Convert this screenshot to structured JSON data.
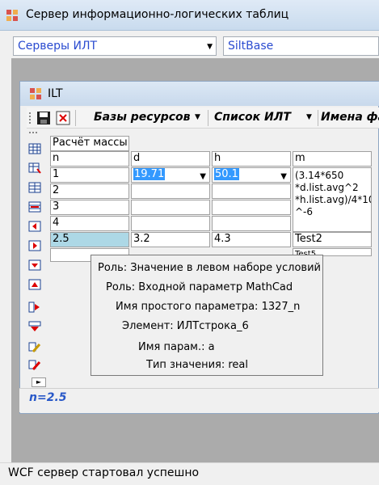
{
  "app": {
    "title": "Сервер информационно-логических таблиц"
  },
  "combos": {
    "servers": "Серверы ИЛТ",
    "base": "SiltBase"
  },
  "child": {
    "title": "ILT"
  },
  "toolbar": {
    "resources": "Базы ресурсов",
    "ilt_list": "Список ИЛТ",
    "names": "Имена фа"
  },
  "table": {
    "caption": "Расчёт массы",
    "headers": [
      "n",
      "d",
      "h",
      "m"
    ],
    "rows": [
      {
        "n": "1",
        "d": "19.71",
        "h": "50.1",
        "m": "(3.14*650 *d.list.avg^2 *h.list.avg)/4*10 ^-6"
      },
      {
        "n": "2",
        "d": "",
        "h": "",
        "m": ""
      },
      {
        "n": "3",
        "d": "",
        "h": "",
        "m": ""
      },
      {
        "n": "4",
        "d": "",
        "h": "",
        "m": ""
      },
      {
        "n": "2.5",
        "d": "3.2",
        "h": "4.3",
        "m": "Test2"
      },
      {
        "n": "",
        "d": "",
        "h": "",
        "m": "Test5"
      }
    ],
    "m_lines": [
      "(3.14*650",
      "*d.list.avg^2",
      "*h.list.avg)/4*10",
      "^-6"
    ]
  },
  "tooltip": {
    "role1": "Роль: Значение в левом наборе условий",
    "role2": "Роль: Входной параметр MathCad",
    "simple_param": "Имя простого параметра: 1327_n",
    "element": "Элемент: ИЛТстрока_6",
    "param_name": "Имя парам.: a",
    "value_type": "Тип значения: real"
  },
  "status_expr": "n=2.5",
  "statusbar": {
    "text": "WCF сервер стартовал успешно"
  },
  "colors": {
    "accent": "#2a4bd0",
    "selection": "#3399ff",
    "selected_cell": "#add8e6",
    "mdi_bg": "#ababab"
  }
}
